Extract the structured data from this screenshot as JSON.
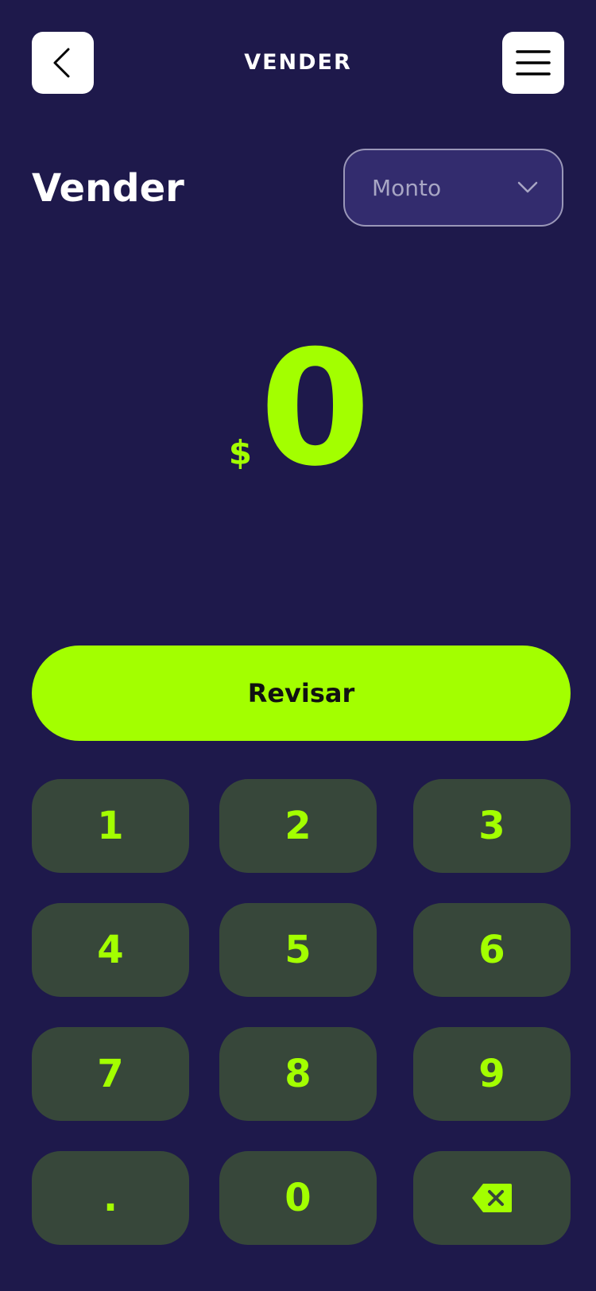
{
  "header": {
    "back_icon": "chevron-left-icon",
    "title": "VENDER",
    "menu_icon": "hamburger-menu-icon"
  },
  "page": {
    "title": "Vender"
  },
  "dropdown": {
    "selected": "Monto",
    "icon": "chevron-down-icon"
  },
  "amount": {
    "currency": "$",
    "value": "0"
  },
  "review_button": {
    "label": "Revisar"
  },
  "keypad": {
    "keys": [
      "1",
      "2",
      "3",
      "4",
      "5",
      "6",
      "7",
      "8",
      "9",
      ".",
      "0"
    ],
    "backspace_icon": "backspace-icon"
  },
  "colors": {
    "background": "#1e194b",
    "accent": "#a3ff00",
    "key_background": "#37473a",
    "dropdown_background": "#332c6e"
  }
}
